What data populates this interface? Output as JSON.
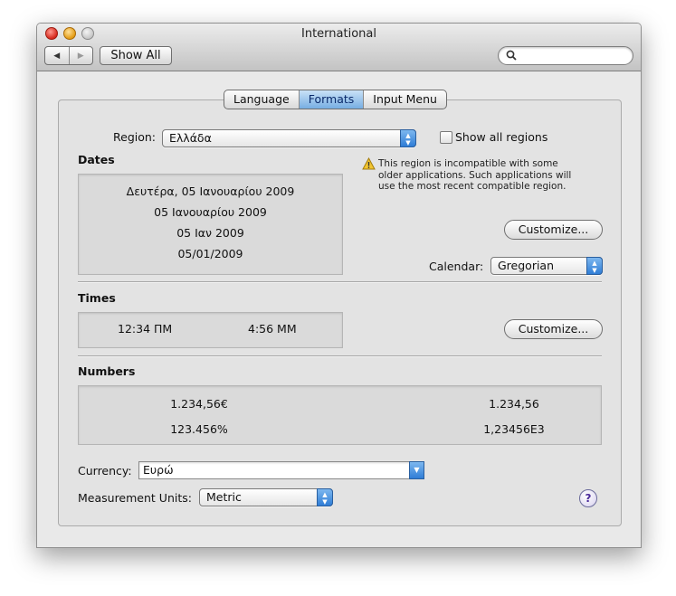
{
  "window": {
    "title": "International"
  },
  "toolbar": {
    "back_icon": "◀",
    "forward_icon": "▶",
    "show_all_label": "Show All",
    "search_placeholder": "",
    "search_icon": "magnifier-icon"
  },
  "tabs": [
    {
      "label": "Language",
      "active": false
    },
    {
      "label": "Formats",
      "active": true
    },
    {
      "label": "Input Menu",
      "active": false
    }
  ],
  "region": {
    "label": "Region:",
    "value": "Ελλάδα",
    "show_all_label": "Show all regions",
    "show_all_checked": false,
    "warning_lines": [
      "This region is incompatible with some",
      "older applications. Such applications will",
      "use the most recent compatible region."
    ]
  },
  "dates": {
    "heading": "Dates",
    "samples": [
      "Δευτέρα, 05 Ιανουαρίου 2009",
      "05 Ιανουαρίου 2009",
      "05 Ιαν 2009",
      "05/01/2009"
    ],
    "customize_label": "Customize...",
    "calendar_label": "Calendar:",
    "calendar_value": "Gregorian"
  },
  "times": {
    "heading": "Times",
    "samples": [
      "12:34 ΠΜ",
      "4:56 ΜΜ"
    ],
    "customize_label": "Customize..."
  },
  "numbers": {
    "heading": "Numbers",
    "samples": [
      "1.234,56€",
      "1.234,56",
      "123.456%",
      "1,23456E3"
    ]
  },
  "currency": {
    "label": "Currency:",
    "value": "Ευρώ"
  },
  "measurement": {
    "label": "Measurement Units:",
    "value": "Metric"
  },
  "help": {
    "label": "?"
  },
  "colors": {
    "accent": "#4a90e2",
    "warning": "#f2c530"
  }
}
